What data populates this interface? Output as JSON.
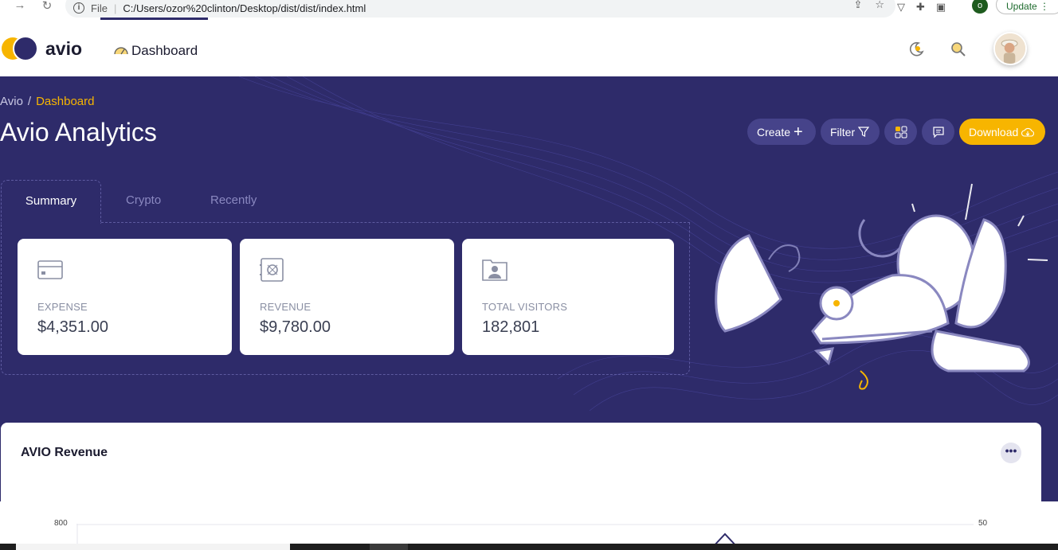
{
  "browser": {
    "scheme": "File",
    "url": "C:/Users/ozor%20clinton/Desktop/dist/dist/index.html",
    "profile_initial": "o",
    "update_label": "Update"
  },
  "header": {
    "brand": "avio",
    "tab_label": "Dashboard"
  },
  "hero": {
    "breadcrumb": {
      "root": "Avio",
      "separator": "/",
      "current": "Dashboard"
    },
    "title": "Avio Analytics",
    "actions": {
      "create_label": "Create",
      "filter_label": "Filter",
      "download_label": "Download"
    },
    "tabs": [
      {
        "label": "Summary"
      },
      {
        "label": "Crypto"
      },
      {
        "label": "Recently"
      }
    ],
    "cards": [
      {
        "label": "EXPENSE",
        "value": "$4,351.00",
        "icon": "credit-card-icon"
      },
      {
        "label": "REVENUE",
        "value": "$9,780.00",
        "icon": "safe-icon"
      },
      {
        "label": "TOTAL VISITORS",
        "value": "182,801",
        "icon": "visitor-icon"
      }
    ]
  },
  "revenue": {
    "title": "AVIO Revenue",
    "more_label": "•••",
    "y_left_top": "800",
    "y_right_top": "50"
  },
  "colors": {
    "primary": "#2e2b6a",
    "accent": "#f7b500",
    "card": "#ffffff"
  }
}
